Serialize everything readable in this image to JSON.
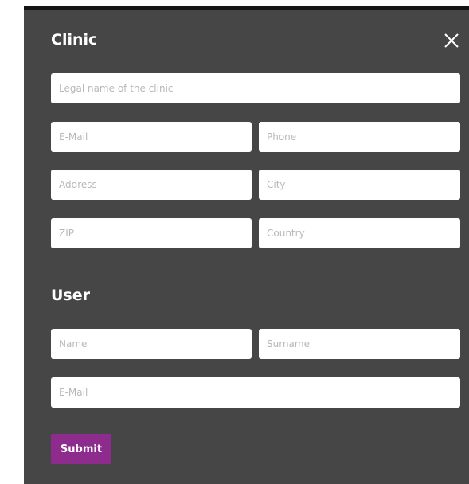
{
  "clinic": {
    "title": "Clinic",
    "legal_name_placeholder": "Legal name of the clinic",
    "email_placeholder": "E-Mail",
    "phone_placeholder": "Phone",
    "address_placeholder": "Address",
    "city_placeholder": "City",
    "zip_placeholder": "ZIP",
    "country_placeholder": "Country"
  },
  "user": {
    "title": "User",
    "name_placeholder": "Name",
    "surname_placeholder": "Surname",
    "email_placeholder": "E-Mail"
  },
  "actions": {
    "submit_label": "Submit",
    "close_icon": "close-icon"
  },
  "colors": {
    "modal_background": "#464646",
    "accent": "#8e2c8e",
    "field_background": "#ffffff"
  }
}
